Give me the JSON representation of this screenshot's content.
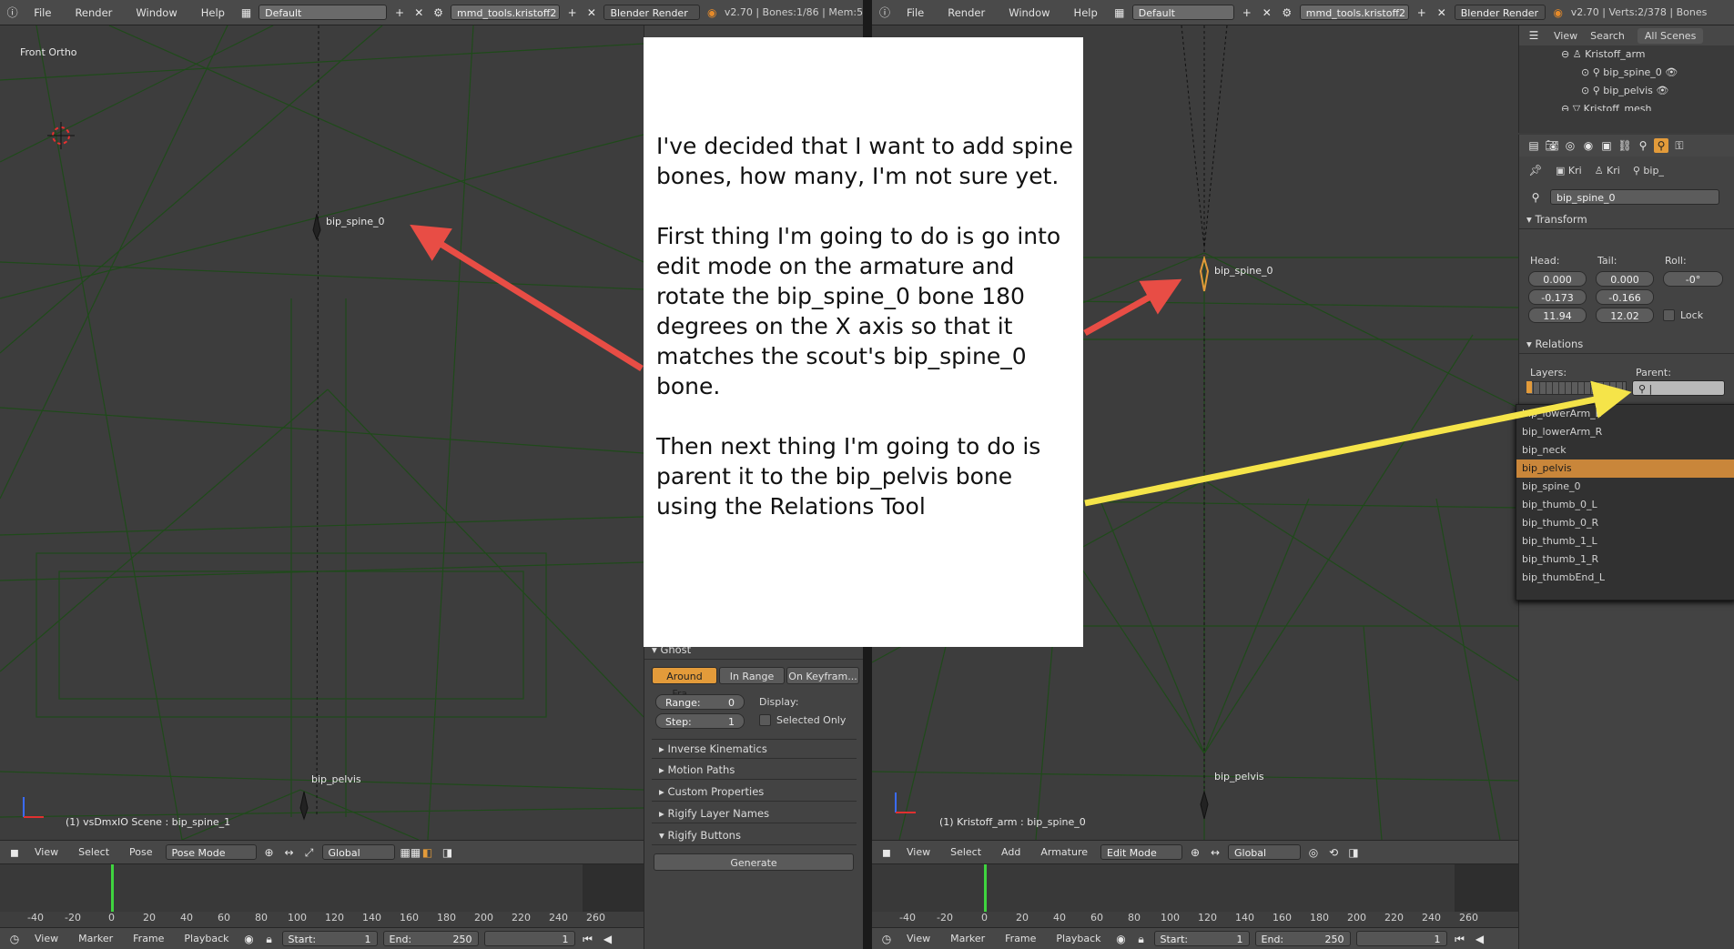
{
  "left": {
    "info_icon": "info-icon",
    "menus": [
      "File",
      "Render",
      "Window",
      "Help"
    ],
    "layout": "Default",
    "scene": "mmd_tools.kristoff2",
    "engine": "Blender Render",
    "stats": "v2.70 | Bones:1/86 | Mem:5",
    "view_name": "Front Ortho",
    "bone_spine": "bip_spine_0",
    "bone_pelvis": "bip_pelvis",
    "status": "(1) vsDmxIO Scene : bip_spine_1",
    "header": {
      "view": "View",
      "select": "Select",
      "pose": "Pose",
      "mode": "Pose Mode",
      "orientation": "Global"
    },
    "timeline_ticks": [
      "-40",
      "-20",
      "0",
      "20",
      "40",
      "60",
      "80",
      "100",
      "120",
      "140",
      "160",
      "180",
      "200",
      "220",
      "240",
      "260"
    ],
    "playback": {
      "view": "View",
      "marker": "Marker",
      "frame": "Frame",
      "playback": "Playback",
      "start_label": "Start:",
      "start": "1",
      "end_label": "End:",
      "end": "250",
      "current": "1"
    }
  },
  "props_left": {
    "ghost": "Ghost",
    "tabs": [
      "Around Fra...",
      "In Range",
      "On Keyfram..."
    ],
    "range_label": "Range:",
    "range": "0",
    "step_label": "Step:",
    "step": "1",
    "display_label": "Display:",
    "selected_only": "Selected Only",
    "panels": [
      "Inverse Kinematics",
      "Motion Paths",
      "Custom Properties",
      "Rigify Layer Names",
      "Rigify Buttons"
    ],
    "generate": "Generate"
  },
  "right": {
    "menus": [
      "File",
      "Render",
      "Window",
      "Help"
    ],
    "layout": "Default",
    "scene": "mmd_tools.kristoff2",
    "engine": "Blender Render",
    "stats": "v2.70 | Verts:2/378 | Bones",
    "bone_spine": "bip_spine_0",
    "bone_pelvis": "bip_pelvis",
    "status": "(1) Kristoff_arm : bip_spine_0",
    "header": {
      "view": "View",
      "select": "Select",
      "add": "Add",
      "armature": "Armature",
      "mode": "Edit Mode",
      "orientation": "Global"
    },
    "timeline_ticks": [
      "-40",
      "-20",
      "0",
      "20",
      "40",
      "60",
      "80",
      "100",
      "120",
      "140",
      "160",
      "180",
      "200",
      "220",
      "240",
      "260"
    ],
    "playback": {
      "view": "View",
      "marker": "Marker",
      "frame": "Frame",
      "playback": "Playback",
      "start_label": "Start:",
      "start": "1",
      "end_label": "End:",
      "end": "250",
      "current": "1"
    }
  },
  "outliner": {
    "tabs": [
      "View",
      "Search",
      "All Scenes"
    ],
    "items": [
      "Kristoff_arm",
      "bip_spine_0",
      "bip_pelvis",
      "Kristoff_mesh"
    ]
  },
  "bone_props": {
    "breadcrumb": [
      "Kri",
      "Kri",
      "bip_"
    ],
    "name": "bip_spine_0",
    "transform": "Transform",
    "head_label": "Head:",
    "tail_label": "Tail:",
    "roll_label": "Roll:",
    "head": [
      "0.000",
      "-0.173",
      "11.94"
    ],
    "tail": [
      "0.000",
      "-0.166",
      "12.02"
    ],
    "roll": "-0°",
    "lock": "Lock",
    "relations": "Relations",
    "layers_label": "Layers:",
    "parent_label": "Parent:",
    "dropdown": [
      "bip_lowerArm_L",
      "bip_lowerArm_R",
      "bip_neck",
      "bip_pelvis",
      "bip_spine_0",
      "bip_thumb_0_L",
      "bip_thumb_0_R",
      "bip_thumb_1_L",
      "bip_thumb_1_R",
      "bip_thumbEnd_L"
    ],
    "dropdown_selected": "bip_pelvis"
  },
  "note": {
    "p1": "I've decided that I want to add spine bones, how many, I'm not sure yet.",
    "p2": "First thing I'm going to do is go into edit mode on the armature and rotate the bip_spine_0 bone 180 degrees on the X axis so that it matches the scout's bip_spine_0 bone.",
    "p3": "Then next thing I'm going to do is parent it to the bip_pelvis bone using the Relations Tool"
  },
  "colors": {
    "accent": "#e39b3a",
    "red_arrow": "#e84d45",
    "yellow_arrow": "#f5e449",
    "wire": "#1f4a1a"
  }
}
